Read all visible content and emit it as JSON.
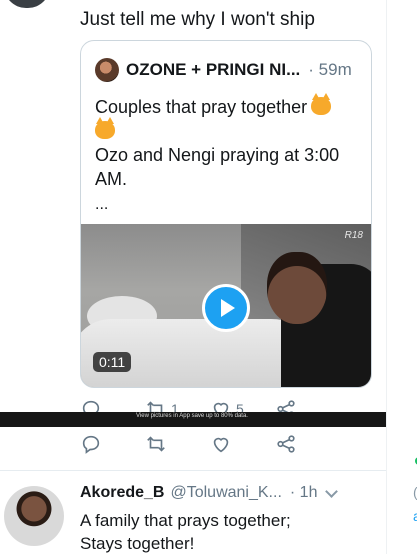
{
  "tweet": {
    "text": "Just tell me why I won't ship"
  },
  "quote": {
    "author": "OZONE + PRINGI NI...",
    "time": "· 59m",
    "line1": "Couples that pray together",
    "line2": "Ozo and Nengi praying at 3:00",
    "line3": "AM.",
    "ellipsis": "...",
    "emoji_icon": "cat-face-emoji-icon",
    "video": {
      "duration": "0:11",
      "rating_tag": "R18"
    }
  },
  "actions_first": {
    "reply_count": "",
    "retweet_count": "1",
    "like_count": "5"
  },
  "overlay": {
    "text": "View pictures in App save up to 80% data."
  },
  "actions_second": {
    "reply_count": "",
    "retweet_count": "",
    "like_count": ""
  },
  "reply": {
    "name": "Akorede_B",
    "handle": "@Toluwani_K...",
    "time": "· 1h",
    "text_line1": "A family that prays together;",
    "text_line2": "Stays together!"
  },
  "colors": {
    "accent": "#1da1f2",
    "muted": "#657786",
    "text": "#14171a",
    "border": "#ccd6dd"
  }
}
